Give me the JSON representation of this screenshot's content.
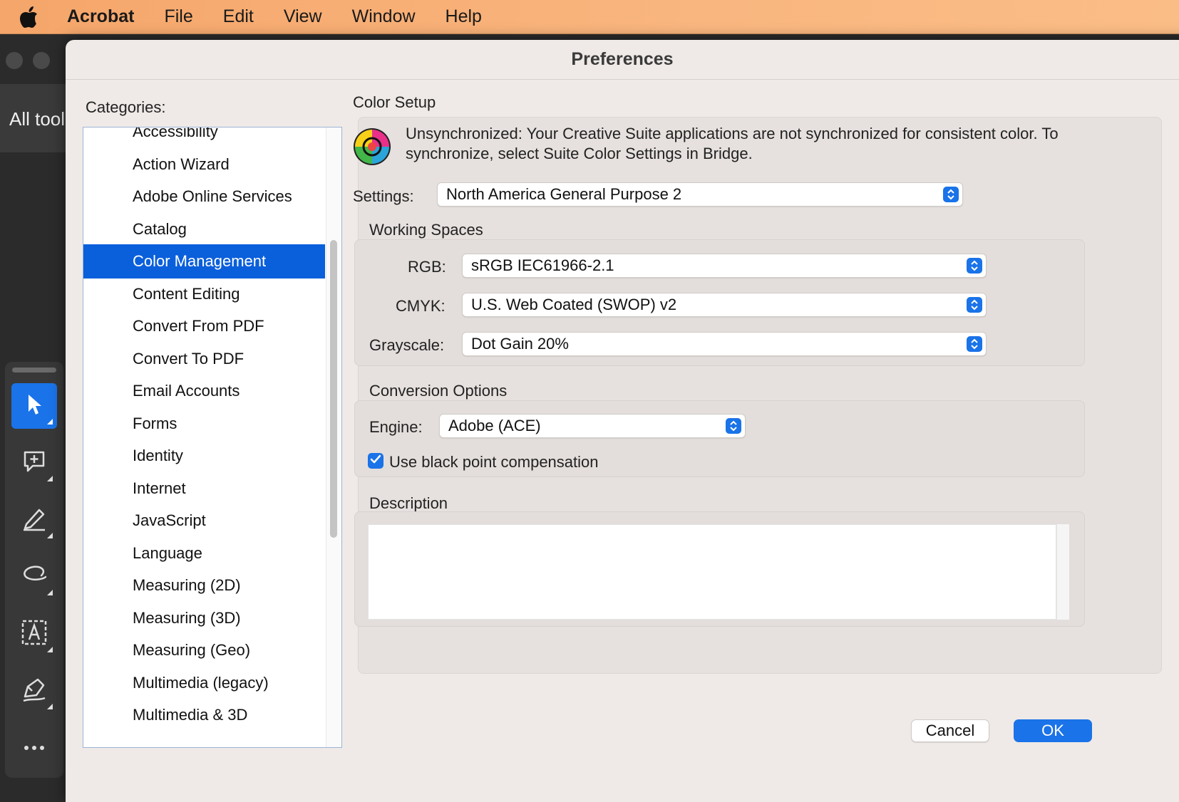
{
  "menubar": {
    "app_name": "Acrobat",
    "items": [
      "File",
      "Edit",
      "View",
      "Window",
      "Help"
    ]
  },
  "background_app": {
    "all_tools_label": "All tool"
  },
  "dialog": {
    "title": "Preferences",
    "categories_label": "Categories:",
    "categories": [
      "Accessibility",
      "Action Wizard",
      "Adobe Online Services",
      "Catalog",
      "Color Management",
      "Content Editing",
      "Convert From PDF",
      "Convert To PDF",
      "Email Accounts",
      "Forms",
      "Identity",
      "Internet",
      "JavaScript",
      "Language",
      "Measuring (2D)",
      "Measuring (3D)",
      "Measuring (Geo)",
      "Multimedia (legacy)",
      "Multimedia & 3D"
    ],
    "selected_category": "Color Management",
    "color_setup": {
      "title": "Color Setup",
      "sync_message": "Unsynchronized: Your Creative Suite applications are not synchronized for consistent color. To synchronize, select Suite Color Settings in Bridge.",
      "settings_label": "Settings:",
      "settings_value": "North America General Purpose 2",
      "working_spaces": {
        "title": "Working Spaces",
        "rgb_label": "RGB:",
        "rgb_value": "sRGB IEC61966-2.1",
        "cmyk_label": "CMYK:",
        "cmyk_value": "U.S. Web Coated (SWOP) v2",
        "grayscale_label": "Grayscale:",
        "grayscale_value": "Dot Gain 20%"
      },
      "conversion_options": {
        "title": "Conversion Options",
        "engine_label": "Engine:",
        "engine_value": "Adobe (ACE)",
        "black_point_label": "Use black point compensation",
        "black_point_checked": true
      },
      "description": {
        "title": "Description",
        "text": ""
      }
    },
    "buttons": {
      "cancel": "Cancel",
      "ok": "OK"
    }
  },
  "colors": {
    "accent": "#1a73e8",
    "selection": "#0a5fdb",
    "menubar": "#f9b67f"
  }
}
